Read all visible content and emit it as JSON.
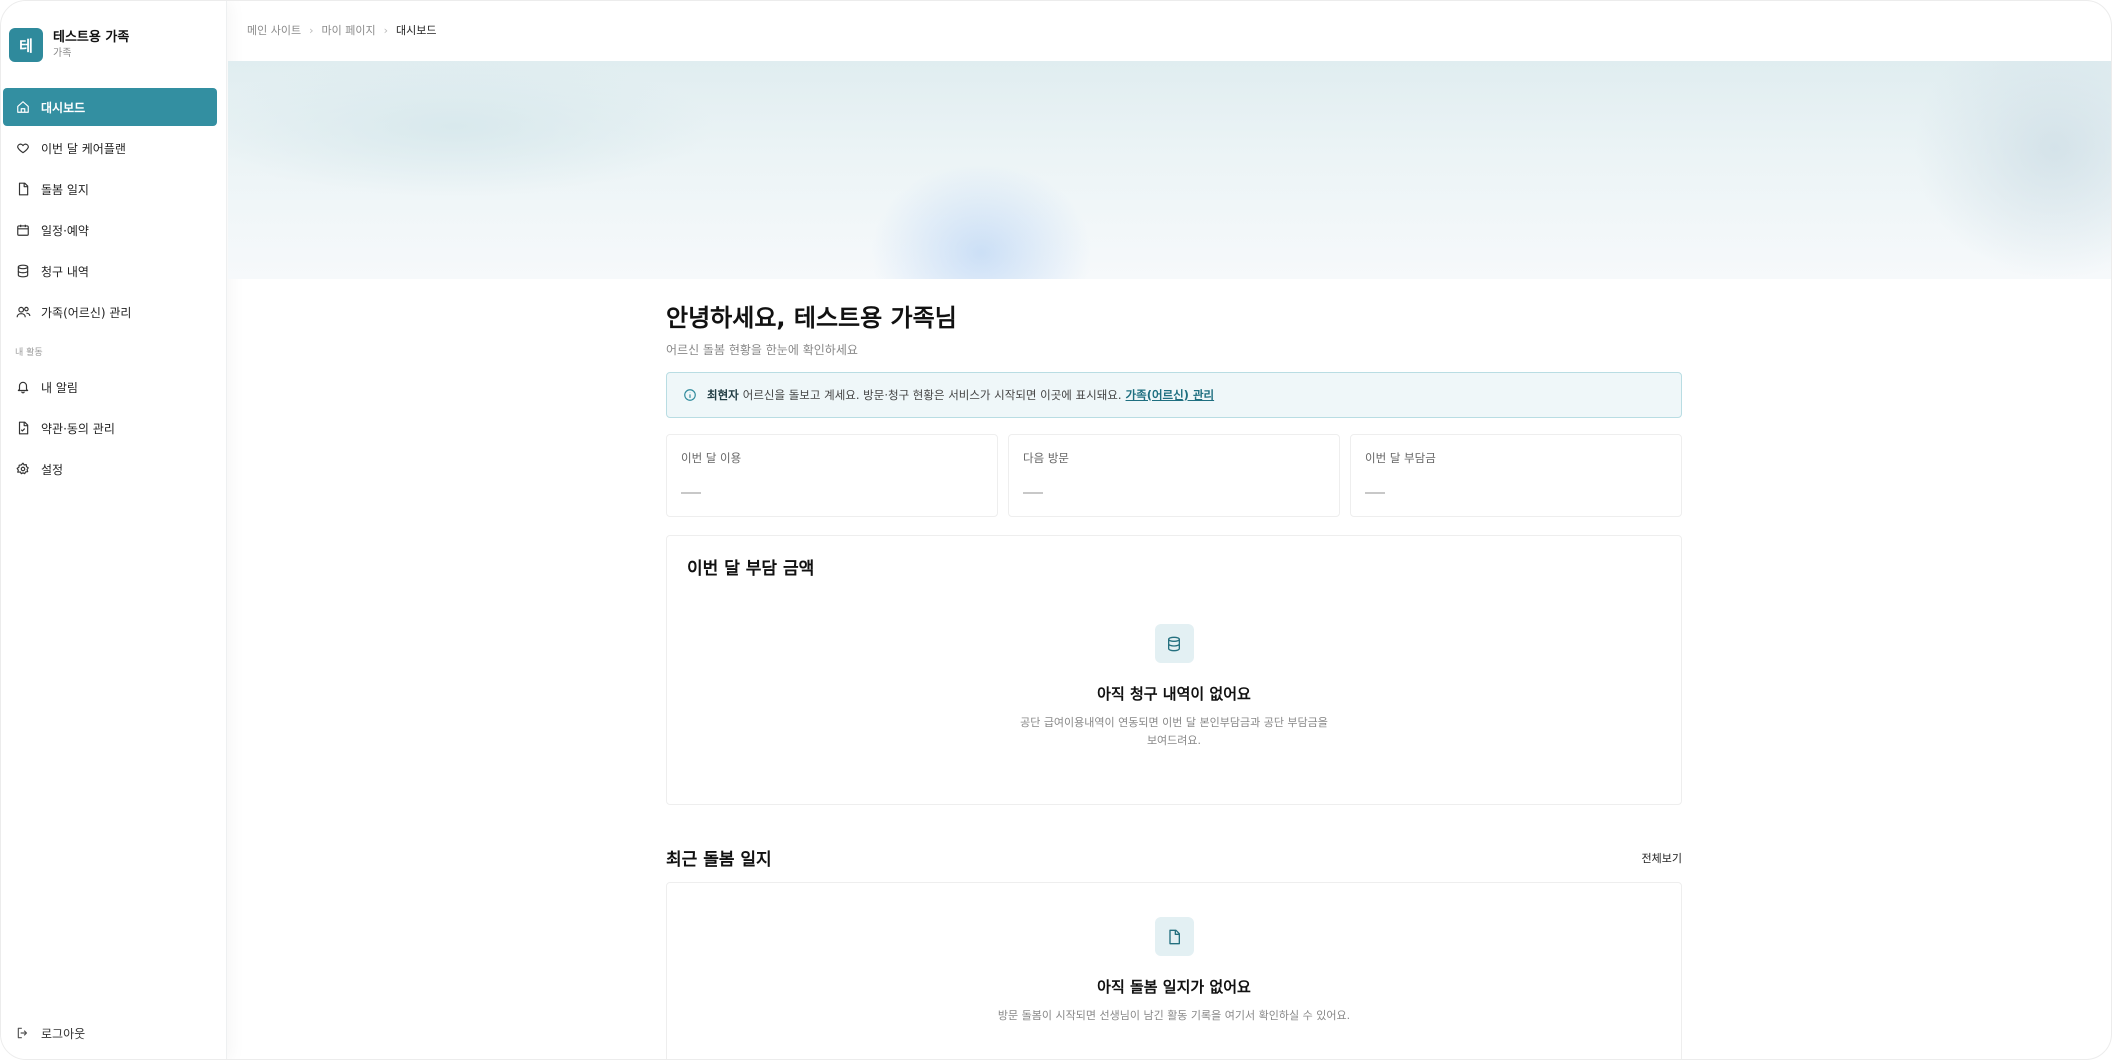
{
  "brand": {
    "logo_letter": "테",
    "name": "테스트용 가족",
    "sub": "가족"
  },
  "sidebar": {
    "items": [
      {
        "label": "대시보드",
        "icon": "home-icon",
        "active": true
      },
      {
        "label": "이번 달 케어플랜",
        "icon": "heart-icon"
      },
      {
        "label": "돌봄 일지",
        "icon": "document-icon"
      },
      {
        "label": "일정·예약",
        "icon": "calendar-icon"
      },
      {
        "label": "청구 내역",
        "icon": "database-icon"
      }
    ],
    "family_manage": {
      "label": "가족(어르신) 관리",
      "icon": "users-icon"
    },
    "section_label": "내 활동",
    "activity_items": [
      {
        "label": "내 알림",
        "icon": "bell-icon"
      },
      {
        "label": "약관·동의 관리",
        "icon": "file-check-icon"
      },
      {
        "label": "설정",
        "icon": "gear-icon"
      }
    ],
    "logout_label": "로그아웃"
  },
  "breadcrumb": {
    "home": "메인 사이트",
    "mypage": "마이 페이지",
    "current": "대시보드"
  },
  "main": {
    "greeting": "안녕하세요, 테스트용 가족님",
    "greeting_sub": "어르신 돌봄 현황을 한눈에 확인하세요",
    "notice": {
      "name": "최현자",
      "text": "어르신을 돌보고 계세요. 방문·청구 현황은 서비스가 시작되면 이곳에 표시돼요.",
      "link": "가족(어르신) 관리"
    },
    "stats": [
      {
        "label": "이번 달 이용"
      },
      {
        "label": "다음 방문"
      },
      {
        "label": "이번 달 부담금"
      }
    ],
    "billing_card": {
      "title": "이번 달 부담 금액",
      "empty_icon": "database-icon",
      "empty_title": "아직 청구 내역이 없어요",
      "empty_desc": "공단 급여이용내역이 연동되면 이번 달 본인부담금과 공단 부담금을 보여드려요."
    },
    "journal": {
      "title": "최근 돌봄 일지",
      "view_all": "전체보기",
      "empty_icon": "document-icon",
      "empty_title": "아직 돌봄 일지가 없어요",
      "empty_desc": "방문 돌봄이 시작되면 선생님이 남긴 활동 기록을 여기서 확인하실 수 있어요."
    }
  },
  "colors": {
    "accent": "#338fa1",
    "notice_bg": "#eff7f9",
    "notice_border": "#b9dde3"
  }
}
